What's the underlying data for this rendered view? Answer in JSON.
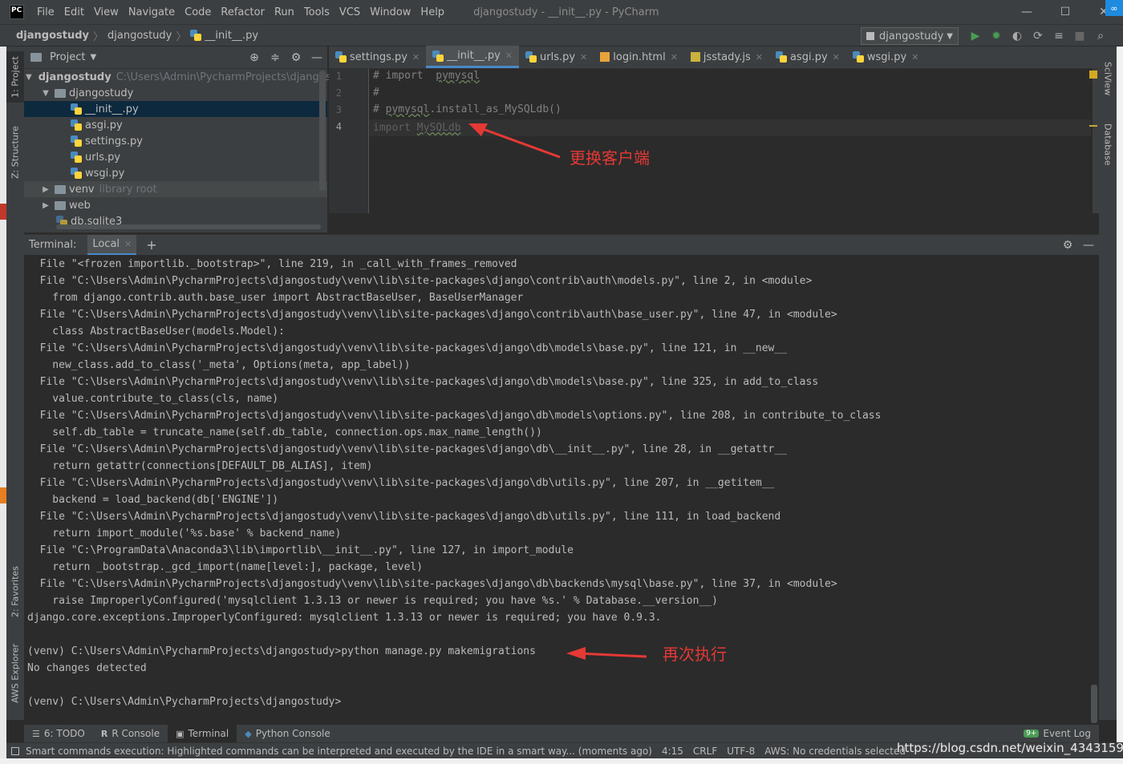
{
  "window": {
    "title": "djangostudy - __init__.py - PyCharm",
    "menu": [
      "File",
      "Edit",
      "View",
      "Navigate",
      "Code",
      "Refactor",
      "Run",
      "Tools",
      "VCS",
      "Window",
      "Help"
    ],
    "app_icon_text": "PC",
    "minimize": "—",
    "maximize": "☐",
    "close": "✕"
  },
  "nav": {
    "crumbs": [
      "djangostudy",
      "djangostudy",
      "__init__.py"
    ],
    "run_config": "djangostudy"
  },
  "left_tabs": [
    "1: Project",
    "Z: Structure",
    "2: Favorites",
    "AWS Explorer"
  ],
  "right_tabs": [
    "SciView",
    "Database"
  ],
  "project": {
    "header": "Project",
    "root": {
      "name": "djangostudy",
      "path": "C:\\Users\\Admin\\PycharmProjects\\djangostudy"
    },
    "package": "djangostudy",
    "files": [
      "__init__.py",
      "asgi.py",
      "settings.py",
      "urls.py",
      "wsgi.py"
    ],
    "selected_file": "__init__.py",
    "venv": {
      "name": "venv",
      "hint": "library root"
    },
    "web": "web",
    "db": "db.sqlite3"
  },
  "editor": {
    "tabs": [
      "settings.py",
      "__init__.py",
      "urls.py",
      "login.html",
      "jsstady.js",
      "asgi.py",
      "wsgi.py"
    ],
    "active_tab": "__init__.py",
    "line_numbers": [
      "1",
      "2",
      "3",
      "4"
    ],
    "lines": [
      {
        "a": "# import  ",
        "b": "pymysql",
        "c": ""
      },
      {
        "a": "#",
        "b": "",
        "c": ""
      },
      {
        "a": "# ",
        "b": "pymysql",
        "c": ".install_as_MySQLdb()"
      },
      {
        "a": "import ",
        "b": "MySQLdb",
        "c": ""
      }
    ],
    "annotation": "更换客户端"
  },
  "terminal": {
    "title": "Terminal:",
    "tab": "Local",
    "lines": [
      "  File \"<frozen importlib._bootstrap>\", line 219, in _call_with_frames_removed",
      "  File \"C:\\Users\\Admin\\PycharmProjects\\djangostudy\\venv\\lib\\site-packages\\django\\contrib\\auth\\models.py\", line 2, in <module>",
      "    from django.contrib.auth.base_user import AbstractBaseUser, BaseUserManager",
      "  File \"C:\\Users\\Admin\\PycharmProjects\\djangostudy\\venv\\lib\\site-packages\\django\\contrib\\auth\\base_user.py\", line 47, in <module>",
      "    class AbstractBaseUser(models.Model):",
      "  File \"C:\\Users\\Admin\\PycharmProjects\\djangostudy\\venv\\lib\\site-packages\\django\\db\\models\\base.py\", line 121, in __new__",
      "    new_class.add_to_class('_meta', Options(meta, app_label))",
      "  File \"C:\\Users\\Admin\\PycharmProjects\\djangostudy\\venv\\lib\\site-packages\\django\\db\\models\\base.py\", line 325, in add_to_class",
      "    value.contribute_to_class(cls, name)",
      "  File \"C:\\Users\\Admin\\PycharmProjects\\djangostudy\\venv\\lib\\site-packages\\django\\db\\models\\options.py\", line 208, in contribute_to_class",
      "    self.db_table = truncate_name(self.db_table, connection.ops.max_name_length())",
      "  File \"C:\\Users\\Admin\\PycharmProjects\\djangostudy\\venv\\lib\\site-packages\\django\\db\\__init__.py\", line 28, in __getattr__",
      "    return getattr(connections[DEFAULT_DB_ALIAS], item)",
      "  File \"C:\\Users\\Admin\\PycharmProjects\\djangostudy\\venv\\lib\\site-packages\\django\\db\\utils.py\", line 207, in __getitem__",
      "    backend = load_backend(db['ENGINE'])",
      "  File \"C:\\Users\\Admin\\PycharmProjects\\djangostudy\\venv\\lib\\site-packages\\django\\db\\utils.py\", line 111, in load_backend",
      "    return import_module('%s.base' % backend_name)",
      "  File \"C:\\ProgramData\\Anaconda3\\lib\\importlib\\__init__.py\", line 127, in import_module",
      "    return _bootstrap._gcd_import(name[level:], package, level)",
      "  File \"C:\\Users\\Admin\\PycharmProjects\\djangostudy\\venv\\lib\\site-packages\\django\\db\\backends\\mysql\\base.py\", line 37, in <module>",
      "    raise ImproperlyConfigured('mysqlclient 1.3.13 or newer is required; you have %s.' % Database.__version__)",
      "django.core.exceptions.ImproperlyConfigured: mysqlclient 1.3.13 or newer is required; you have 0.9.3.",
      "",
      "(venv) C:\\Users\\Admin\\PycharmProjects\\djangostudy>python manage.py makemigrations",
      "No changes detected",
      "",
      "(venv) C:\\Users\\Admin\\PycharmProjects\\djangostudy>"
    ],
    "annotation": "再次执行"
  },
  "bottom_tabs": [
    {
      "icon": "☰",
      "label": "6: TODO"
    },
    {
      "icon": "R",
      "label": "R Console"
    },
    {
      "icon": "▣",
      "label": "Terminal"
    },
    {
      "icon": "◆",
      "label": "Python Console"
    }
  ],
  "event_log": {
    "badge": "9+",
    "label": "Event Log"
  },
  "status": {
    "message": "Smart commands execution: Highlighted commands can be interpreted and executed by the IDE in a smart way... (moments ago)",
    "position": "4:15",
    "line_sep": "CRLF",
    "encoding": "UTF-8",
    "aws": "AWS: No credentials selected"
  },
  "watermark": "https://blog.csdn.net/weixin_43431593",
  "colors": {
    "accent": "#4a88c7",
    "annotation_red": "#e53935",
    "selection": "#0d293e"
  }
}
